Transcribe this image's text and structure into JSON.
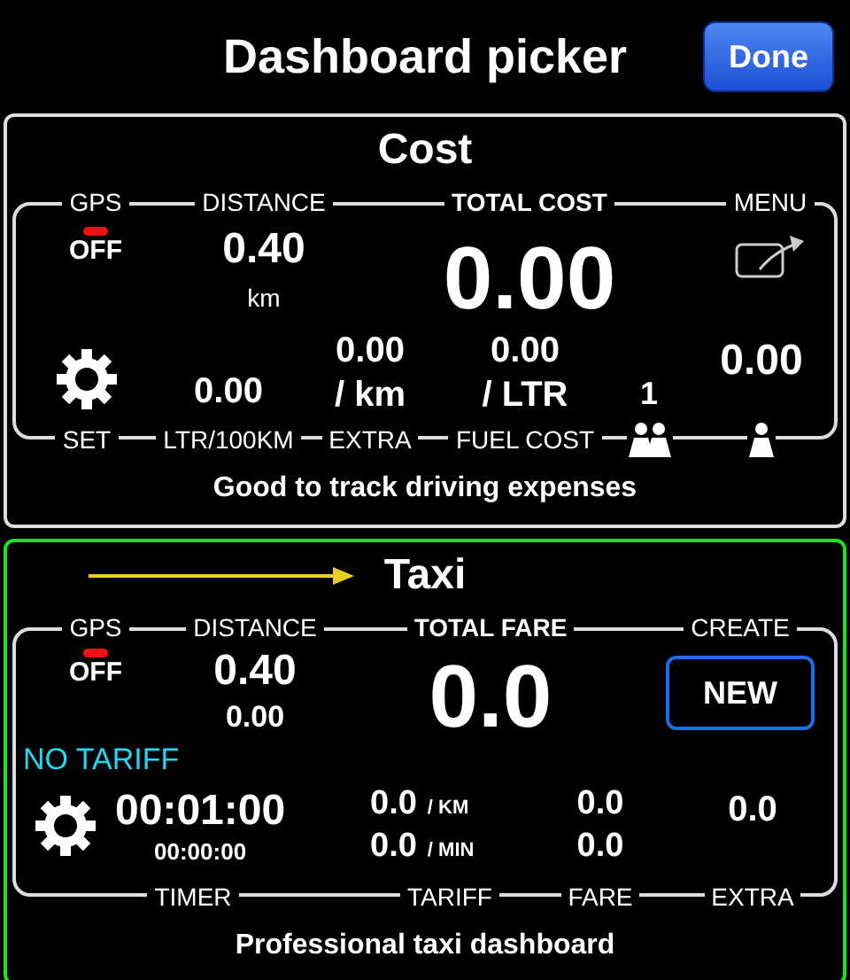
{
  "header": {
    "title": "Dashboard picker",
    "done_button": "Done"
  },
  "dashboards": [
    {
      "kind": "cost",
      "title": "Cost",
      "selected": false,
      "top_labels": [
        "GPS",
        "DISTANCE",
        "TOTAL COST",
        "MENU"
      ],
      "gps": {
        "status": "OFF",
        "on": false
      },
      "distance": "0.40",
      "distance_unit": "km",
      "total": "0.00",
      "consumption": "0.00",
      "extra": "0.00",
      "extra_unit": "/ km",
      "fuel_cost": "0.00",
      "fuel_unit": "/ LTR",
      "passengers": "1",
      "per_person": "0.00",
      "bottom_labels": [
        "SET",
        "LTR/100KM",
        "EXTRA",
        "FUEL COST"
      ],
      "description": "Good to track driving expenses"
    },
    {
      "kind": "taxi",
      "title": "Taxi",
      "selected": true,
      "top_labels": [
        "GPS",
        "DISTANCE",
        "TOTAL FARE",
        "CREATE"
      ],
      "gps": {
        "status": "OFF",
        "on": false
      },
      "distance": "0.40",
      "distance_fare": "0.00",
      "total": "0.0",
      "new_button": "NEW",
      "tariff_status": "NO TARIFF",
      "timer": "00:01:00",
      "timer_wait": "00:00:00",
      "rate_km": "0.0",
      "rate_km_unit": "/ KM",
      "rate_min": "0.0",
      "rate_min_unit": "/ MIN",
      "fare_km": "0.0",
      "fare_min": "0.0",
      "extra": "0.0",
      "bottom_labels": [
        "TIMER",
        "TARIFF",
        "FARE",
        "EXTRA"
      ],
      "description": "Professional taxi dashboard"
    }
  ]
}
